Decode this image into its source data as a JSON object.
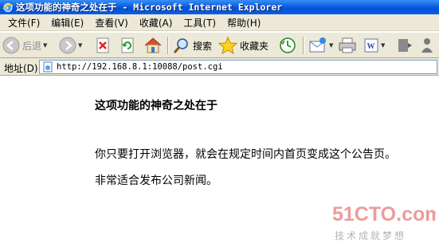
{
  "window": {
    "title": "这项功能的神奇之处在于 - Microsoft Internet Explorer",
    "app_icon": "ie-icon"
  },
  "menu": [
    "文件(F)",
    "编辑(E)",
    "查看(V)",
    "收藏(A)",
    "工具(T)",
    "帮助(H)"
  ],
  "toolbar": {
    "back_label": "后退",
    "search_label": "搜索",
    "favorites_label": "收藏夹"
  },
  "address": {
    "label": "地址(D)",
    "url": "http://192.168.8.1:10088/post.cgi"
  },
  "page": {
    "heading": "这项功能的神奇之处在于",
    "paragraphs": [
      "你只要打开浏览器，就会在规定时间内首页变成这个公告页。",
      "非常适合发布公司新闻。"
    ]
  },
  "watermark": {
    "logo": "51CTO.com",
    "slogan": "技术成就梦想"
  },
  "colors": {
    "titlebar": "#0a5fe0",
    "chrome": "#ece9d8",
    "watermark_red": "#e87a7a"
  }
}
